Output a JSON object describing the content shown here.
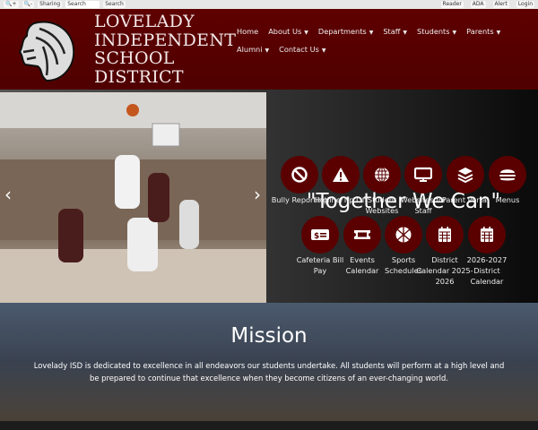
{
  "toolbar": {
    "sharing": "Sharing",
    "search_placeholder": "Search",
    "search_button": "Search",
    "reader": "Reader",
    "ada": "ADA",
    "alert": "Alert",
    "login": "Login"
  },
  "header": {
    "school_name": [
      "LOVELADY",
      "INDEPENDENT",
      "SCHOOL",
      "DISTRICT"
    ],
    "nav": [
      {
        "label": "Home",
        "dropdown": false
      },
      {
        "label": "About Us",
        "dropdown": true
      },
      {
        "label": "Departments",
        "dropdown": true
      },
      {
        "label": "Staff",
        "dropdown": true
      },
      {
        "label": "Students",
        "dropdown": true
      },
      {
        "label": "Parents",
        "dropdown": true
      },
      {
        "label": "Alumni",
        "dropdown": true
      },
      {
        "label": "Contact Us",
        "dropdown": true
      }
    ]
  },
  "hero": {
    "slogan": "\"Together We Can\"",
    "prev": "‹",
    "next": "›",
    "quick_links": [
      {
        "label": "Bully Reporting",
        "icon": "ban-icon"
      },
      {
        "label": "Hotline/Tip Off",
        "icon": "warning-icon"
      },
      {
        "label": "Student Websites",
        "icon": "globe-icon"
      },
      {
        "label": "Websites for Staff",
        "icon": "monitor-icon"
      },
      {
        "label": "Parent Portal",
        "icon": "layers-icon"
      },
      {
        "label": "Menus",
        "icon": "burger-icon"
      },
      {
        "label": "Cafeteria Bill Pay",
        "icon": "bill-icon"
      },
      {
        "label": "Events Calendar",
        "icon": "ticket-icon"
      },
      {
        "label": "Sports Schedules",
        "icon": "basketball-icon"
      },
      {
        "label": "District Calendar 2025-2026",
        "icon": "calendar-icon"
      },
      {
        "label": "2026-2027 District Calendar",
        "icon": "calendar-icon"
      }
    ]
  },
  "mission": {
    "title": "Mission",
    "text": "Lovelady ISD is dedicated to excellence in all endeavors our students undertake. All students will perform at a high level and be prepared to continue that excellence when they become citizens of an ever-changing world."
  },
  "colors": {
    "maroon": "#5a0000"
  }
}
